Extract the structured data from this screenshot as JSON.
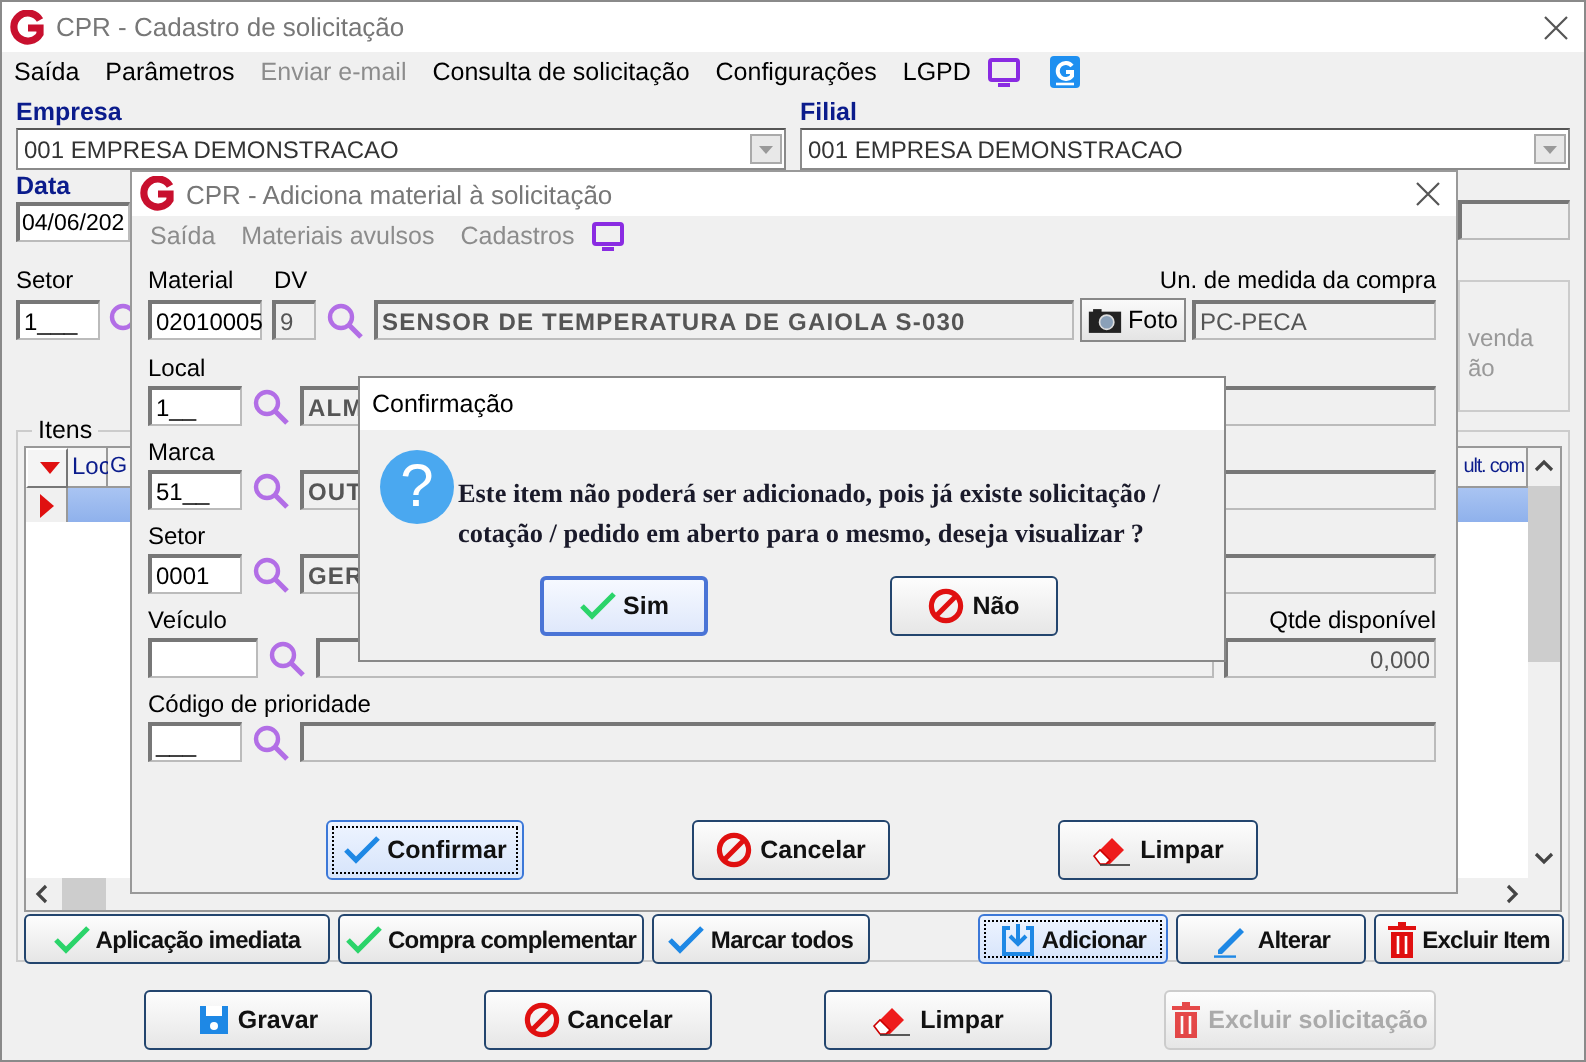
{
  "window": {
    "title": "CPR - Cadastro de solicitação"
  },
  "menu": [
    {
      "label": "Saída",
      "disabled": false
    },
    {
      "label": "Parâmetros",
      "disabled": false
    },
    {
      "label": "Enviar e-mail",
      "disabled": true
    },
    {
      "label": "Consulta de solicitação",
      "disabled": false
    },
    {
      "label": "Configurações",
      "disabled": false
    },
    {
      "label": "LGPD",
      "disabled": false
    }
  ],
  "empresa": {
    "label": "Empresa",
    "value": "001 EMPRESA DEMONSTRACAO"
  },
  "filial": {
    "label": "Filial",
    "value": "001 EMPRESA DEMONSTRACAO"
  },
  "data": {
    "label": "Data",
    "value": "04/06/202"
  },
  "setor": {
    "label": "Setor",
    "value": "1___"
  },
  "side_panel": {
    "lines": [
      "venda",
      "ão"
    ]
  },
  "itens": {
    "title": "Itens",
    "columns": [
      "Loc",
      "G",
      "ult. com"
    ],
    "rows": [
      {
        "selected": true
      }
    ]
  },
  "item_buttons": [
    {
      "label": "Aplicação imediata",
      "kind": "apply",
      "focused": false
    },
    {
      "label": "Compra complementar",
      "kind": "apply",
      "focused": false
    },
    {
      "label": "Marcar todos",
      "kind": "mark",
      "focused": false
    },
    {
      "label": "Adicionar",
      "kind": "add",
      "focused": true
    },
    {
      "label": "Alterar",
      "kind": "edit",
      "focused": false
    },
    {
      "label": "Excluir Item",
      "kind": "delete",
      "focused": false
    }
  ],
  "buttons": [
    {
      "label": "Gravar",
      "kind": "save",
      "disabled": false
    },
    {
      "label": "Cancelar",
      "kind": "cancel",
      "disabled": false
    },
    {
      "label": "Limpar",
      "kind": "clear",
      "disabled": false
    },
    {
      "label": "Excluir solicitação",
      "kind": "delete",
      "disabled": true
    }
  ],
  "material_window": {
    "title": "CPR - Adiciona material à solicitação",
    "menu": [
      {
        "label": "Saída",
        "disabled": true
      },
      {
        "label": "Materiais avulsos",
        "disabled": true
      },
      {
        "label": "Cadastros",
        "disabled": true
      }
    ],
    "material": {
      "label": "Material",
      "value": "02010005"
    },
    "dv": {
      "label": "DV",
      "value": "9"
    },
    "description": "SENSOR DE TEMPERATURA DE GAIOLA S-030",
    "photo_button": "Foto",
    "unit": {
      "label": "Un. de medida da compra",
      "value": "PC-PECA"
    },
    "lookups": [
      {
        "label": "Local",
        "code": "1__",
        "description": "ALM"
      },
      {
        "label": "Marca",
        "code": "51__",
        "description": "OUT"
      },
      {
        "label": "Setor",
        "code": "0001",
        "description": "GER"
      },
      {
        "label": "Veículo",
        "extra": {
          "label": "Qtde disponível",
          "value": "0,000"
        }
      },
      {
        "label": "Código de prioridade",
        "code": "___"
      }
    ],
    "buttons": [
      {
        "label": "Confirmar",
        "kind": "mark",
        "focused": true
      },
      {
        "label": "Cancelar",
        "kind": "cancel",
        "focused": false
      },
      {
        "label": "Limpar",
        "kind": "clear",
        "focused": false
      }
    ]
  },
  "dialog": {
    "title": "Confirmação",
    "icon_glyph": "?",
    "message": "Este item não poderá ser adicionado, pois já existe solicitação / cotação / pedido em aberto para o mesmo, deseja visualizar ?",
    "buttons": [
      {
        "label": "Sim",
        "kind": "apply",
        "default": true
      },
      {
        "label": "Não",
        "kind": "cancel",
        "default": false
      }
    ]
  }
}
